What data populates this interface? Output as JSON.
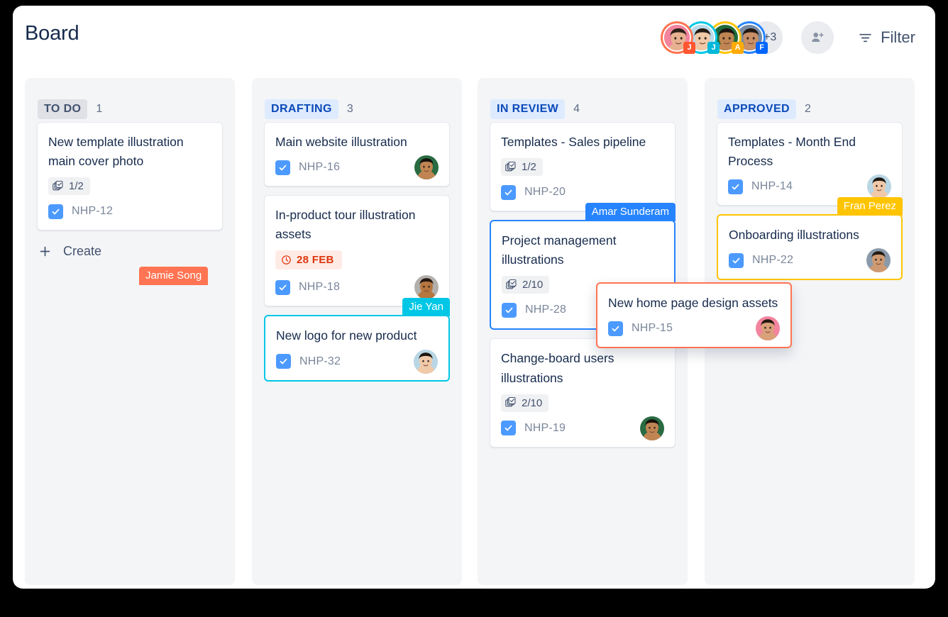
{
  "header": {
    "title": "Board",
    "members": [
      {
        "initial": "J",
        "ring": "#ff7452",
        "badge": "#ff5630",
        "skin": "#e8b292",
        "hair": "#2b2119",
        "bg": "#f2849e"
      },
      {
        "initial": "J",
        "ring": "#00c7e6",
        "badge": "#00b8d9",
        "skin": "#f0c9a8",
        "hair": "#241b14",
        "bg": "#bcd9e8"
      },
      {
        "initial": "A",
        "ring": "#ffc400",
        "badge": "#ffab00",
        "skin": "#c08552",
        "hair": "#1c1410",
        "bg": "#1f6b3d"
      },
      {
        "initial": "F",
        "ring": "#2684ff",
        "badge": "#0065ff",
        "skin": "#c98f66",
        "hair": "#231a13",
        "bg": "#7a8ca3"
      }
    ],
    "overflow_count": "+3",
    "add_person_label": "add-person",
    "filter_label": "Filter"
  },
  "columns": [
    {
      "name": "TO DO",
      "count": "1",
      "chip_style": "grey",
      "cards": [
        {
          "title": "New template illustration main cover photo",
          "subtasks": "1/2",
          "key": "NHP-12",
          "avatar": null,
          "due": null,
          "selection": null,
          "tag": null
        }
      ],
      "create_label": "Create"
    },
    {
      "name": "DRAFTING",
      "count": "3",
      "chip_style": "blue",
      "cards": [
        {
          "title": "Main website illustration",
          "subtasks": null,
          "key": "NHP-16",
          "avatar": {
            "skin": "#c08552",
            "hair": "#15100c",
            "bg": "#2a6b42"
          },
          "due": null,
          "selection": null,
          "tag": null
        },
        {
          "title": "In-product tour illustration assets",
          "subtasks": null,
          "key": "NHP-18",
          "avatar": {
            "skin": "#b5763f",
            "hair": "#241610",
            "bg": "#b3b0ac"
          },
          "due": "28 FEB",
          "selection": null,
          "tag": null
        },
        {
          "title": "New logo for new product",
          "subtasks": null,
          "key": "NHP-32",
          "avatar": {
            "skin": "#f0c9a8",
            "hair": "#1d1610",
            "bg": "#b9d6e4"
          },
          "due": null,
          "selection": "cyan",
          "tag": {
            "label": "Jie Yan",
            "style": "cyan"
          }
        }
      ],
      "create_label": null
    },
    {
      "name": "IN REVIEW",
      "count": "4",
      "chip_style": "blue",
      "cards": [
        {
          "title": "Templates - Sales pipeline",
          "subtasks": "1/2",
          "key": "NHP-20",
          "avatar": null,
          "due": null,
          "selection": null,
          "tag": null
        },
        {
          "title": "Project management illustrations",
          "subtasks": "2/10",
          "key": "NHP-28",
          "avatar": {
            "skin": "#c08552",
            "hair": "#15100c",
            "bg": "#2a6b42"
          },
          "due": null,
          "selection": "blue",
          "tag": {
            "label": "Amar Sunderam",
            "style": "blue"
          }
        },
        {
          "title": "Change-board users illustrations",
          "subtasks": "2/10",
          "key": "NHP-19",
          "avatar": {
            "skin": "#c08552",
            "hair": "#15100c",
            "bg": "#2a6b42"
          },
          "due": null,
          "selection": null,
          "tag": null
        }
      ],
      "create_label": null
    },
    {
      "name": "APPROVED",
      "count": "2",
      "chip_style": "blue",
      "cards": [
        {
          "title": "Templates - Month End Process",
          "subtasks": null,
          "key": "NHP-14",
          "avatar": {
            "skin": "#f0c9a8",
            "hair": "#1d1610",
            "bg": "#b9d6e4"
          },
          "due": null,
          "selection": null,
          "tag": null
        },
        {
          "title": "Onboarding illustrations",
          "subtasks": null,
          "key": "NHP-22",
          "avatar": {
            "skin": "#cf9a72",
            "hair": "#241a12",
            "bg": "#8a9aab"
          },
          "due": null,
          "selection": "yellow",
          "tag": {
            "label": "Fran Perez",
            "style": "yellow"
          }
        }
      ],
      "create_label": null
    }
  ],
  "dragging_card": {
    "title": "New home page design assets",
    "key": "NHP-15",
    "tag": {
      "label": "Jamie Song",
      "style": "orange"
    },
    "avatar": {
      "skin": "#d9a07a",
      "hair": "#241810",
      "bg": "#f2849e"
    }
  },
  "colors": {
    "accent_blue": "#2684ff",
    "checkbox_blue": "#4c9aff",
    "cyan": "#00c7e6",
    "yellow": "#ffc400",
    "orange": "#ff7452",
    "due_red": "#de350b",
    "column_bg": "#f4f5f7",
    "text_primary": "#172b4d",
    "text_muted": "#7a869a"
  }
}
